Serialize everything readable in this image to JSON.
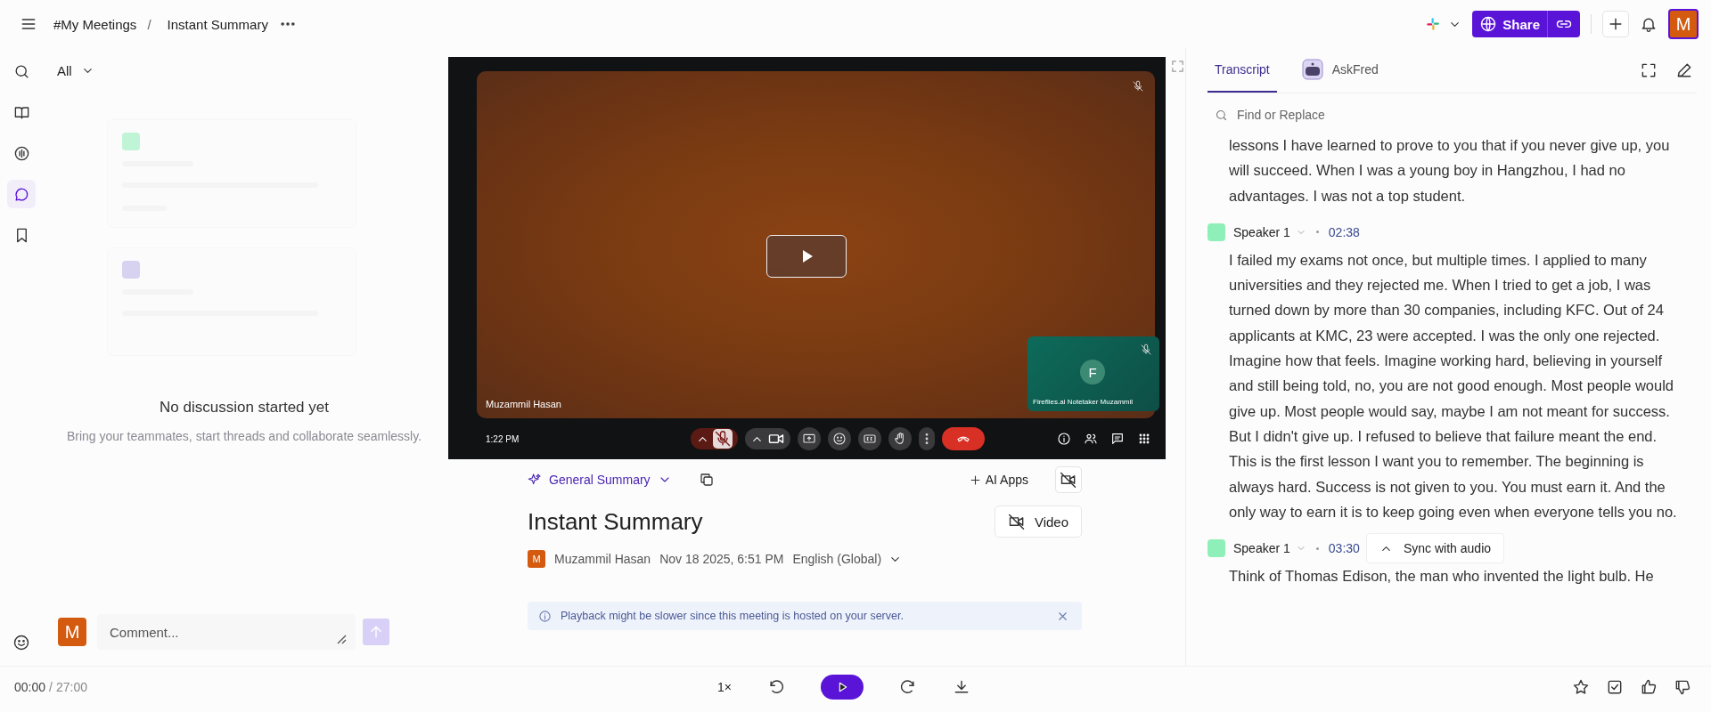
{
  "breadcrumb": [
    "#My Meetings",
    "Instant Summary"
  ],
  "breadcrumb_separator": "/",
  "header": {
    "share_label": "Share",
    "avatar_initial": "M"
  },
  "rail": [
    {
      "kind": "search",
      "selected": false
    },
    {
      "kind": "book",
      "selected": false
    },
    {
      "kind": "audio",
      "selected": false
    },
    {
      "kind": "chat",
      "selected": true
    },
    {
      "kind": "bookmark",
      "selected": false
    }
  ],
  "comments": {
    "filter": "All",
    "empty_title": "No discussion started yet",
    "empty_text": "Bring your teammates, start threads and collaborate seamlessly.",
    "avatar_initial": "M",
    "placeholder": "Comment..."
  },
  "video": {
    "speaker_name": "Muzammil Hasan",
    "clock": "1:22 PM",
    "tile_initial": "F",
    "tile_name": "Fireflies.ai Notetaker Muzammil"
  },
  "summary": {
    "template": "General Summary",
    "ai_apps": "AI Apps",
    "title": "Instant Summary",
    "video_button": "Video",
    "author_initial": "M",
    "author": "Muzammil Hasan",
    "date": "Nov 18 2025, 6:51 PM",
    "language": "English (Global)",
    "notice": "Playback might be slower since this meeting is hosted on your server."
  },
  "transcript": {
    "tabs": [
      {
        "label": "Transcript",
        "selected": true
      },
      {
        "label": "AskFred",
        "selected": false
      }
    ],
    "search_placeholder": "Find or Replace",
    "segments": [
      {
        "text": "lessons I have learned to prove to you that if you never give up, you will succeed. When I was a young boy in Hangzhou, I had no advantages. I was not a top student."
      },
      {
        "speaker": "Speaker 1",
        "time": "02:38",
        "text": "I failed my exams not once, but multiple times. I applied to many universities and they rejected me. When I tried to get a job, I was turned down by more than 30 companies, including KFC. Out of 24 applicants at KMC, 23 were accepted. I was the only one rejected. Imagine how that feels. Imagine working hard, believing in yourself and still being told, no, you are not good enough. Most people would give up. Most people would say, maybe I am not meant for success. But I didn't give up. I refused to believe that failure meant the end. This is the first lesson I want you to remember. The beginning is always hard. Success is not given to you. You must earn it. And the only way to earn it is to keep going even when everyone tells you no."
      },
      {
        "speaker": "Speaker 1",
        "time": "03:30",
        "text": "Think of Thomas Edison, the man who invented the light bulb. He"
      }
    ],
    "sync_label": "Sync with audio"
  },
  "player": {
    "position": "00:00",
    "separator": "/",
    "duration": "27:00",
    "speed": "1×"
  }
}
